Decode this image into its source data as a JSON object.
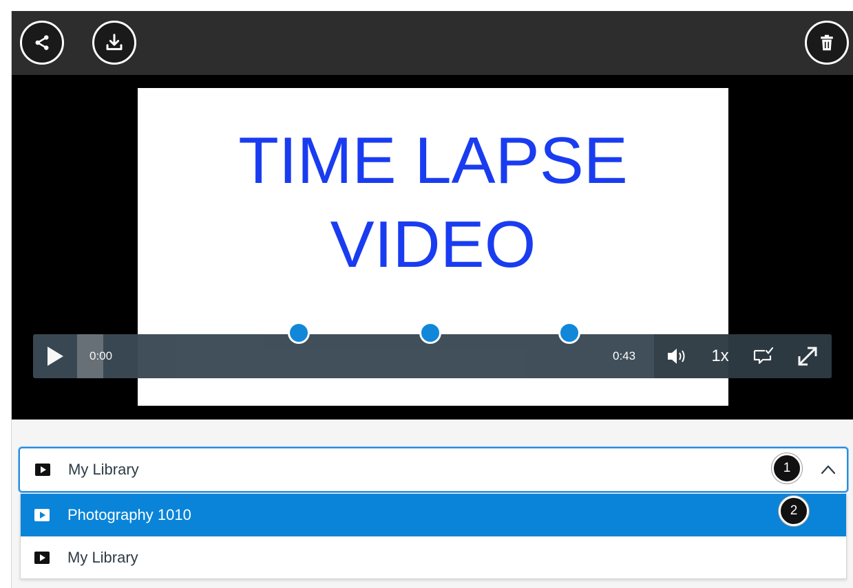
{
  "toolbar": {
    "icons": [
      "share-icon",
      "download-icon",
      "trash-icon"
    ],
    "bg_color": "#2d2d2d"
  },
  "player": {
    "slide_title": "TIME LAPSE\nVIDEO",
    "current_time": "0:00",
    "duration": "0:43",
    "playback_rate": "1x",
    "buffered_fraction": 0.03,
    "comment_markers": 3,
    "accent_color": "#0a84d8",
    "title_color": "#1a3cf0"
  },
  "library_select": {
    "selected_label": "My Library",
    "expanded": true,
    "options": [
      {
        "label": "Photography 1010",
        "highlighted": true
      },
      {
        "label": "My Library",
        "highlighted": false
      }
    ]
  },
  "callouts": [
    "1",
    "2"
  ]
}
